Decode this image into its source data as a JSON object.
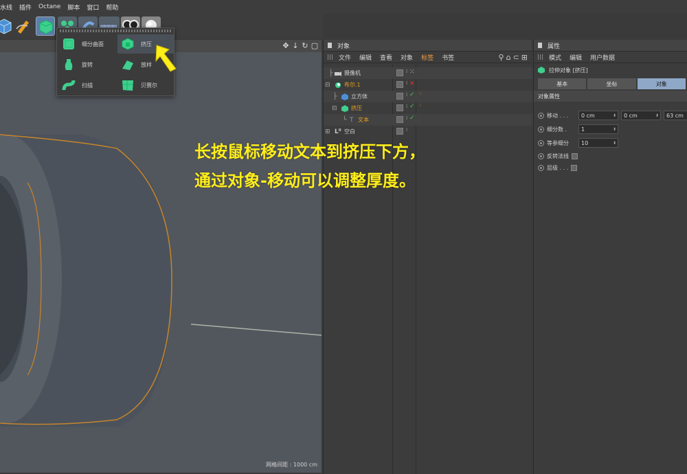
{
  "menubar": {
    "items": [
      "水线",
      "插件",
      "Octane",
      "脚本",
      "窗口",
      "帮助"
    ]
  },
  "flyout": {
    "items": [
      {
        "label": "细分曲面",
        "icon": "subdivision-surface-icon"
      },
      {
        "label": "挤压",
        "icon": "extrude-icon"
      },
      {
        "label": "旋转",
        "icon": "lathe-icon"
      },
      {
        "label": "放样",
        "icon": "loft-icon"
      },
      {
        "label": "扫描",
        "icon": "sweep-icon"
      },
      {
        "label": "贝赛尔",
        "icon": "bezier-icon"
      }
    ]
  },
  "viewport": {
    "grid_label": "网格间距 : 1000 cm"
  },
  "objects_panel": {
    "title": "对象",
    "menu": [
      "文件",
      "编辑",
      "查看",
      "对象",
      "标签",
      "书签"
    ],
    "active_menu": "标签",
    "rows": [
      {
        "name": "摄像机",
        "color": "#d0d0d0",
        "icon": "camera-icon"
      },
      {
        "name": "布尔.1",
        "color": "#e8a020",
        "icon": "boole-icon"
      },
      {
        "name": "立方体",
        "color": "#d0d0d0",
        "icon": "cube-icon"
      },
      {
        "name": "挤压",
        "color": "#e8a020",
        "icon": "extrude-icon"
      },
      {
        "name": "文本",
        "color": "#e8a020",
        "icon": "text-spline-icon"
      },
      {
        "name": "空白",
        "color": "#d0d0d0",
        "icon": "null-icon"
      }
    ]
  },
  "attributes_panel": {
    "title": "属性",
    "menu": [
      "模式",
      "编辑",
      "用户数据"
    ],
    "object_name": "拉伸对象 [挤压]",
    "tabs": [
      "基本",
      "坐标",
      "对象"
    ],
    "active_tab": "对象",
    "section": "对象属性",
    "fields": {
      "move_label": "移动 . . .",
      "move_x": "0 cm",
      "move_y": "0 cm",
      "move_z": "63 cm",
      "subdiv_label": "细分数 .",
      "subdiv_value": "1",
      "iso_label": "等参细分",
      "iso_value": "10",
      "flip_label": "反转法线",
      "hierarchy_label": "层级 . . ."
    }
  },
  "annotation": {
    "line1": "长按鼠标移动文本到挤压下方，",
    "line2": "通过对象-移动可以调整厚度。"
  },
  "colors": {
    "accent_orange": "#e8a020",
    "annotation_yellow": "#ffee1a",
    "active_tab": "#8fa8c8",
    "check_green": "#4cc44c",
    "x_red": "#e03030"
  }
}
